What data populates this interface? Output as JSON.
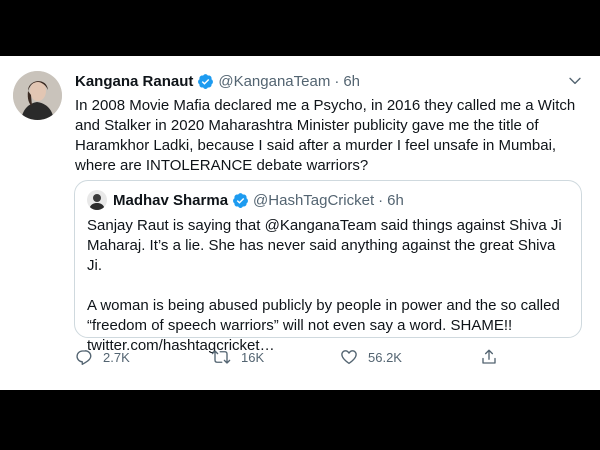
{
  "tweet": {
    "display_name": "Kangana Ranaut",
    "handle": "@KanganaTeam",
    "separator": "·",
    "time": "6h",
    "text": "In 2008 Movie Mafia declared me a Psycho, in 2016 they called me a Witch and Stalker in 2020 Maharashtra Minister publicity gave me the title of Haramkhor Ladki, because I said after a murder I feel unsafe in Mumbai, where are INTOLERANCE debate warriors?",
    "menu_icon": "chevron-down-icon",
    "accent_color": "#1d9bf0"
  },
  "quote": {
    "display_name": "Madhav Sharma",
    "handle": "@HashTagCricket",
    "separator": "·",
    "time": "6h",
    "paragraph1": "Sanjay Raut is saying that @KanganaTeam said things against Shiva Ji Maharaj. It’s a lie. She has never said anything against the great Shiva Ji.",
    "paragraph2": "A woman is being abused publicly by people in power and the so called “freedom of speech warriors” will not even say a word. SHAME!! twitter.com/hashtagcricket…"
  },
  "actions": {
    "reply_count": "2.7K",
    "retweet_count": "16K",
    "like_count": "56.2K",
    "icons": [
      "reply-icon",
      "retweet-icon",
      "like-icon",
      "share-icon"
    ]
  }
}
